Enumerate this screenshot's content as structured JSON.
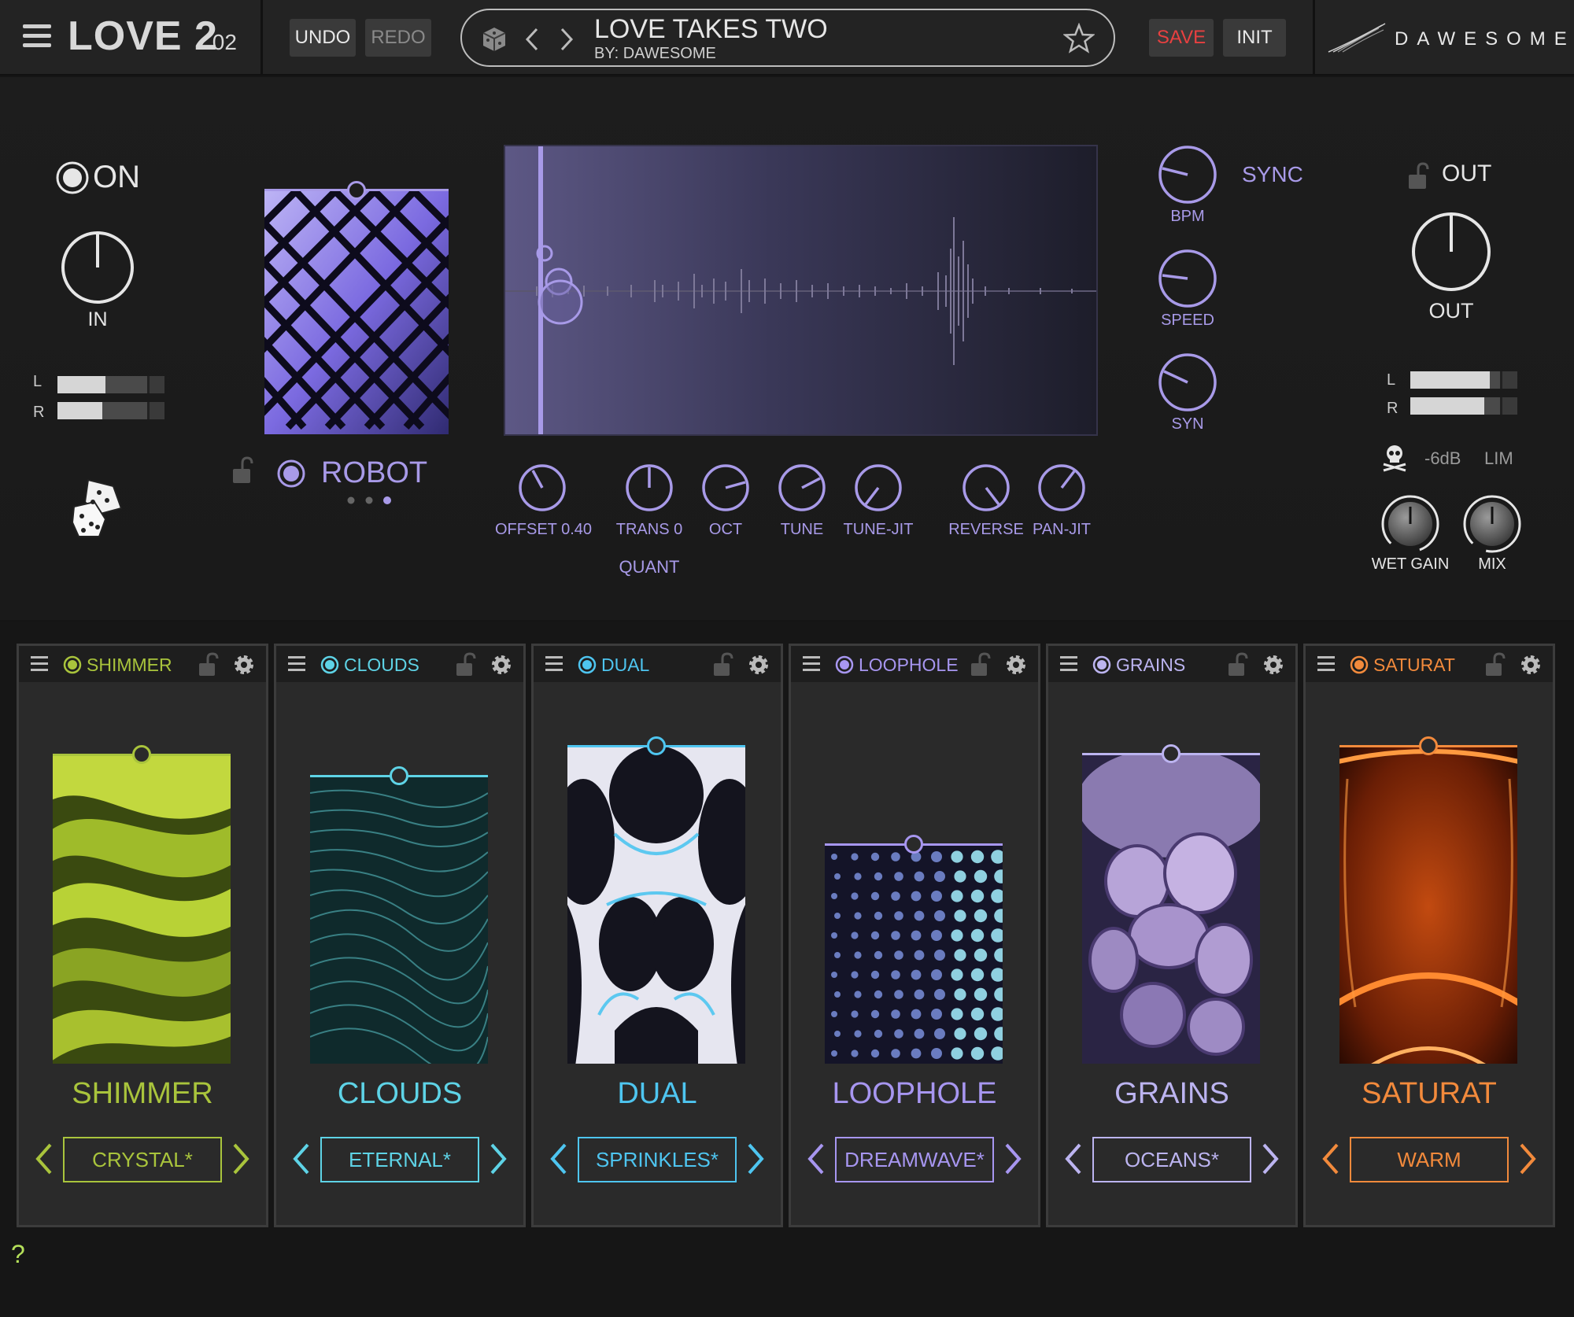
{
  "header": {
    "app_name": "LOVE 2",
    "version": ".02",
    "undo_label": "UNDO",
    "redo_label": "REDO",
    "preset_name": "LOVE TAKES TWO",
    "preset_author": "BY: DAWESOME",
    "save_label": "SAVE",
    "init_label": "INIT",
    "brand": "DAWESOME"
  },
  "input": {
    "power_label": "ON",
    "in_label": "IN",
    "meter_l_label": "L",
    "meter_r_label": "R",
    "meter_l_level": 0.45,
    "meter_r_level": 0.42
  },
  "engine": {
    "name": "ROBOT",
    "page_dots": 3,
    "active_dot": 3
  },
  "waveform": {
    "knobs": [
      {
        "label": "OFFSET 0.40"
      },
      {
        "label": "TRANS 0"
      },
      {
        "label": "OCT"
      },
      {
        "label": "TUNE"
      },
      {
        "label": "TUNE-JIT"
      },
      {
        "label": "REVERSE"
      },
      {
        "label": "PAN-JIT"
      }
    ],
    "quant_label": "QUANT"
  },
  "timing": {
    "sync_label": "SYNC",
    "bpm_label": "BPM",
    "speed_label": "SPEED",
    "syn_label": "SYN"
  },
  "output": {
    "out_header": "OUT",
    "out_knob_label": "OUT",
    "meter_l_label": "L",
    "meter_r_label": "R",
    "meter_l_level": 0.74,
    "meter_r_level": 0.69,
    "db_label": "-6dB",
    "lim_label": "LIM",
    "wet_gain_label": "WET GAIN",
    "mix_label": "MIX"
  },
  "slots": [
    {
      "title": "SHIMMER",
      "name": "SHIMMER",
      "preset": "CRYSTAL*",
      "color": "#a9c43c"
    },
    {
      "title": "CLOUDS",
      "name": "CLOUDS",
      "preset": "ETERNAL*",
      "color": "#5ed3e6"
    },
    {
      "title": "DUAL",
      "name": "DUAL",
      "preset": "SPRINKLES*",
      "color": "#4ec5f0"
    },
    {
      "title": "LOOPHOLE",
      "name": "LOOPHOLE",
      "preset": "DREAMWAVE*",
      "color": "#a796f0"
    },
    {
      "title": "GRAINS",
      "name": "GRAINS",
      "preset": "OCEANS*",
      "color": "#bcb4f0"
    },
    {
      "title": "SATURAT",
      "name": "SATURAT",
      "preset": "WARM",
      "color": "#f28a3c"
    }
  ],
  "footer": {
    "help_label": "?"
  },
  "colors": {
    "accent_purple": "#a89ae8",
    "save_red": "#e84040",
    "panel_bg": "#1b1b1b"
  }
}
